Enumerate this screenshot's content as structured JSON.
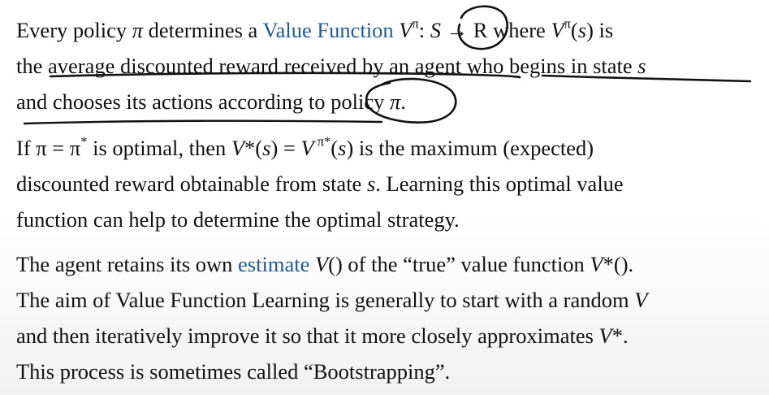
{
  "paragraphs": [
    {
      "lines": [
        [
          {
            "t": "Every policy "
          },
          {
            "t": "π",
            "m": 1
          },
          {
            "t": " determines a "
          },
          {
            "t": "Value Function",
            "hl": 1
          },
          {
            "t": " "
          },
          {
            "t": "V",
            "m": 1
          },
          {
            "t": "π",
            "sup": 1
          },
          {
            "t": ": "
          },
          {
            "t": "S",
            "m": 1
          },
          {
            "t": " → R where "
          },
          {
            "t": "V",
            "m": 1
          },
          {
            "t": "π",
            "sup": 1
          },
          {
            "t": "("
          },
          {
            "t": "s",
            "m": 1
          },
          {
            "t": ") is"
          }
        ],
        [
          {
            "t": "the average discounted reward received by an agent who begins in state "
          },
          {
            "t": "s",
            "m": 1
          }
        ],
        [
          {
            "t": "and chooses its actions according to policy "
          },
          {
            "t": "π",
            "m": 1
          },
          {
            "t": "."
          }
        ]
      ]
    },
    {
      "lines": [
        [
          {
            "t": "If π = π"
          },
          {
            "t": "*",
            "sup": 1
          },
          {
            "t": " is optimal, then "
          },
          {
            "t": "V",
            "m": 1
          },
          {
            "t": "*"
          },
          {
            "t": "("
          },
          {
            "t": "s",
            "m": 1
          },
          {
            "t": ") = "
          },
          {
            "t": "V",
            "m": 1
          },
          {
            "t": " π",
            "sup": 1
          },
          {
            "t": "*",
            "sup": 1
          },
          {
            "t": "("
          },
          {
            "t": "s",
            "m": 1
          },
          {
            "t": ") is the maximum (expected)"
          }
        ],
        [
          {
            "t": "discounted reward obtainable from state "
          },
          {
            "t": "s",
            "m": 1
          },
          {
            "t": ". Learning this optimal value"
          }
        ],
        [
          {
            "t": "function can help to determine the optimal strategy."
          }
        ]
      ]
    },
    {
      "lines": [
        [
          {
            "t": "The agent retains its own "
          },
          {
            "t": "estimate",
            "hl": 1
          },
          {
            "t": " "
          },
          {
            "t": "V",
            "m": 1
          },
          {
            "t": "() of the “true” value function "
          },
          {
            "t": "V",
            "m": 1
          },
          {
            "t": "*()."
          }
        ],
        [
          {
            "t": "The aim of Value Function Learning is generally to start with a random "
          },
          {
            "t": "V",
            "m": 1
          }
        ],
        [
          {
            "t": "and then iteratively improve it so that it more closely approximates "
          },
          {
            "t": "V",
            "m": 1
          },
          {
            "t": "*."
          }
        ],
        [
          {
            "t": "This process is sometimes called “Bootstrapping”."
          }
        ]
      ]
    }
  ]
}
